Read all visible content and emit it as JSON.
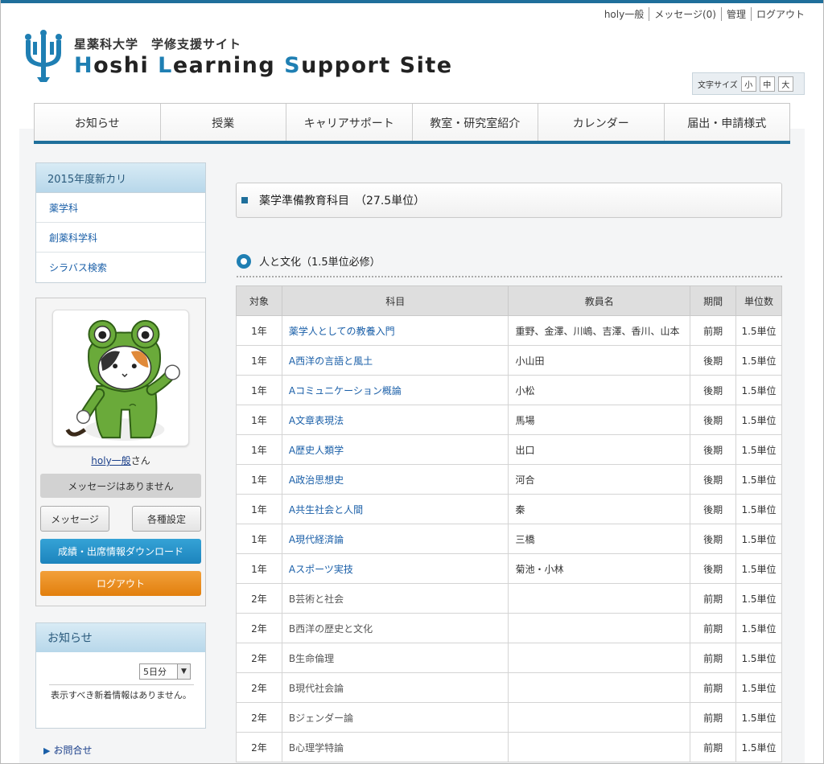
{
  "header": {
    "brand_jp": "星薬科大学　学修支援サイト",
    "brand_en_parts": [
      "H",
      "o",
      "shi ",
      "L",
      "earning ",
      "S",
      "upport Site"
    ],
    "util_links": [
      "holy一般",
      "メッセージ(0)",
      "管理",
      "ログアウト"
    ],
    "font_size": {
      "label": "文字サイズ",
      "small": "小",
      "medium": "中",
      "large": "大"
    }
  },
  "nav": [
    "お知らせ",
    "授業",
    "キャリアサポート",
    "教室・研究室紹介",
    "カレンダー",
    "届出・申請様式"
  ],
  "sidebar": {
    "menu_title": "2015年度新カリ",
    "menu_items": [
      "薬学科",
      "創薬科学科",
      "シラバス検索"
    ],
    "user": {
      "name": "holy一般",
      "suffix": "さん",
      "message_status": "メッセージはありません",
      "message_button": "メッセージ",
      "settings_button": "各種設定",
      "download_button": "成績・出席情報ダウンロード",
      "logout_button": "ログアウト"
    },
    "news": {
      "title": "お知らせ",
      "period_selected": "5日分",
      "empty_text": "表示すべき新着情報はありません。"
    },
    "footer_link": "お問合せ"
  },
  "main": {
    "title": "薬学準備教育科目　（27.5単位）",
    "section_title": "人と文化（1.5単位必修）",
    "table": {
      "headers": [
        "対象",
        "科目",
        "教員名",
        "期間",
        "単位数"
      ],
      "rows": [
        {
          "year": "1年",
          "subject": "薬学人としての教養入門",
          "instructor": "重野、金澤、川嶋、吉澤、香川、山本",
          "term": "前期",
          "credits": "1.5単位",
          "link": true
        },
        {
          "year": "1年",
          "subject": "A西洋の言語と風土",
          "instructor": "小山田",
          "term": "後期",
          "credits": "1.5単位",
          "link": true
        },
        {
          "year": "1年",
          "subject": "Aコミュニケーション概論",
          "instructor": "小松",
          "term": "後期",
          "credits": "1.5単位",
          "link": true
        },
        {
          "year": "1年",
          "subject": "A文章表現法",
          "instructor": "馬場",
          "term": "後期",
          "credits": "1.5単位",
          "link": true
        },
        {
          "year": "1年",
          "subject": "A歴史人類学",
          "instructor": "出口",
          "term": "後期",
          "credits": "1.5単位",
          "link": true
        },
        {
          "year": "1年",
          "subject": "A政治思想史",
          "instructor": "河合",
          "term": "後期",
          "credits": "1.5単位",
          "link": true
        },
        {
          "year": "1年",
          "subject": "A共生社会と人間",
          "instructor": "秦",
          "term": "後期",
          "credits": "1.5単位",
          "link": true
        },
        {
          "year": "1年",
          "subject": "A現代経済論",
          "instructor": "三橋",
          "term": "後期",
          "credits": "1.5単位",
          "link": true
        },
        {
          "year": "1年",
          "subject": "Aスポーツ実技",
          "instructor": "菊池・小林",
          "term": "後期",
          "credits": "1.5単位",
          "link": true
        },
        {
          "year": "2年",
          "subject": "B芸術と社会",
          "instructor": "",
          "term": "前期",
          "credits": "1.5単位",
          "link": false
        },
        {
          "year": "2年",
          "subject": "B西洋の歴史と文化",
          "instructor": "",
          "term": "前期",
          "credits": "1.5単位",
          "link": false
        },
        {
          "year": "2年",
          "subject": "B生命倫理",
          "instructor": "",
          "term": "前期",
          "credits": "1.5単位",
          "link": false
        },
        {
          "year": "2年",
          "subject": "B現代社会論",
          "instructor": "",
          "term": "前期",
          "credits": "1.5単位",
          "link": false
        },
        {
          "year": "2年",
          "subject": "Bジェンダー論",
          "instructor": "",
          "term": "前期",
          "credits": "1.5単位",
          "link": false
        },
        {
          "year": "2年",
          "subject": "B心理学特論",
          "instructor": "",
          "term": "前期",
          "credits": "1.5単位",
          "link": false
        }
      ]
    }
  },
  "colors": {
    "accent": "#1f6f9b",
    "link": "#1a5fa8",
    "download": "#1c84bd",
    "logout": "#e27f0d"
  }
}
